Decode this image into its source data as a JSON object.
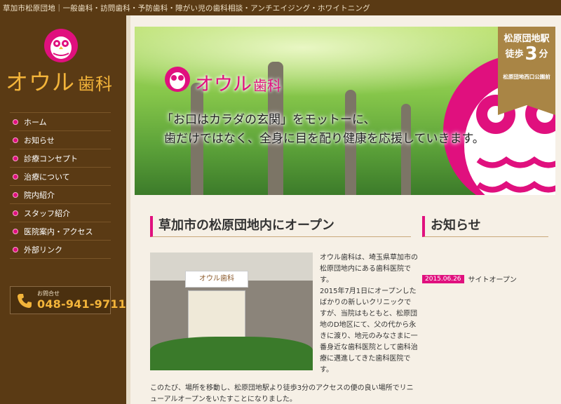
{
  "topbar": {
    "text": "草加市松原団地｜一般歯科・訪問歯科・予防歯科・障がい児の歯科相談・アンチエイジング・ホワイトニング"
  },
  "sidebar": {
    "logo_main": "オウル",
    "logo_sub": "歯科",
    "nav": [
      "ホーム",
      "お知らせ",
      "診療コンセプト",
      "治療について",
      "院内紹介",
      "スタッフ紹介",
      "医院案内・アクセス",
      "外部リンク"
    ],
    "contact_label": "お問合せ",
    "contact_phone": "048-941-9711"
  },
  "hero": {
    "brand_main": "オウル",
    "brand_sub": "歯科",
    "tagline_1": "「お口はカラダの玄関」をモットーに、",
    "tagline_2": "歯だけではなく、全身に目を配り健康を応援していきます。",
    "badge_line1": "松原団地駅",
    "badge_walk": "徒歩",
    "badge_minutes": "3",
    "badge_unit": "分",
    "badge_line3": "松原団地西口公園前"
  },
  "open_section": {
    "heading": "草加市の松原団地内にオープン",
    "sign_text": "オウル歯科",
    "paragraph_1": "オウル歯科は、埼玉県草加市の松原団地内にある歯科医院です。",
    "paragraph_2": "2015年7月1日にオープンしたばかりの新しいクリニックですが、当院はもともと、松原団地のD地区にて、父の代から永きに渡り、地元のみなさまに一番身近な歯科医院として歯科治療に邁進してきた歯科医院です。",
    "paragraph_3": "このたび、場所を移動し、松原団地駅より徒歩3分のアクセスの便の良い場所でリニューアルオープンをいたすことになりました。"
  },
  "news_section": {
    "heading": "お知らせ",
    "items": [
      {
        "date": "2015.06.26",
        "title": "サイトオープン"
      }
    ]
  },
  "colors": {
    "brown": "#5a3a14",
    "pink": "#e0107e",
    "gold": "#f3b43a",
    "badge": "#a98545"
  }
}
